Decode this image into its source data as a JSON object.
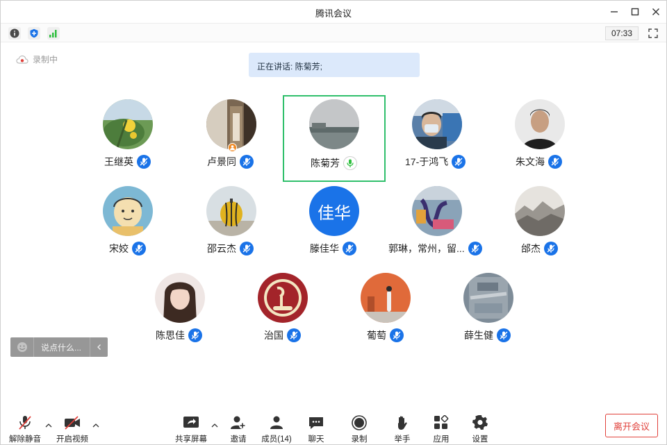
{
  "window": {
    "title": "腾讯会议"
  },
  "infobar": {
    "timer": "07:33"
  },
  "recording": {
    "label": "录制中"
  },
  "speaking": {
    "text": "正在讲话: 陈菊芳;"
  },
  "participants": [
    {
      "name": "王继英"
    },
    {
      "name": "卢景同"
    },
    {
      "name": "陈菊芳"
    },
    {
      "name": "17-于鸿飞"
    },
    {
      "name": "朱文海"
    },
    {
      "name": "宋姣"
    },
    {
      "name": "邵云杰"
    },
    {
      "name": "滕佳华",
      "avatar_text": "佳华"
    },
    {
      "name": "郭琳，常州，留..."
    },
    {
      "name": "邰杰"
    },
    {
      "name": "陈思佳"
    },
    {
      "name": "治国"
    },
    {
      "name": "葡萄"
    },
    {
      "name": "薛生健"
    }
  ],
  "chat": {
    "placeholder": "说点什么..."
  },
  "toolbar": {
    "unmute": "解除静音",
    "start_video": "开启视频",
    "share_screen": "共享屏幕",
    "invite": "邀请",
    "members": "成员(14)",
    "chat": "聊天",
    "record": "录制",
    "raise_hand": "举手",
    "apps": "应用",
    "settings": "设置",
    "leave": "离开会议"
  },
  "colors": {
    "accent": "#1a73e8",
    "active_border": "#2fbf6b",
    "leave": "#e0403a",
    "banner": "#dce9fb"
  }
}
